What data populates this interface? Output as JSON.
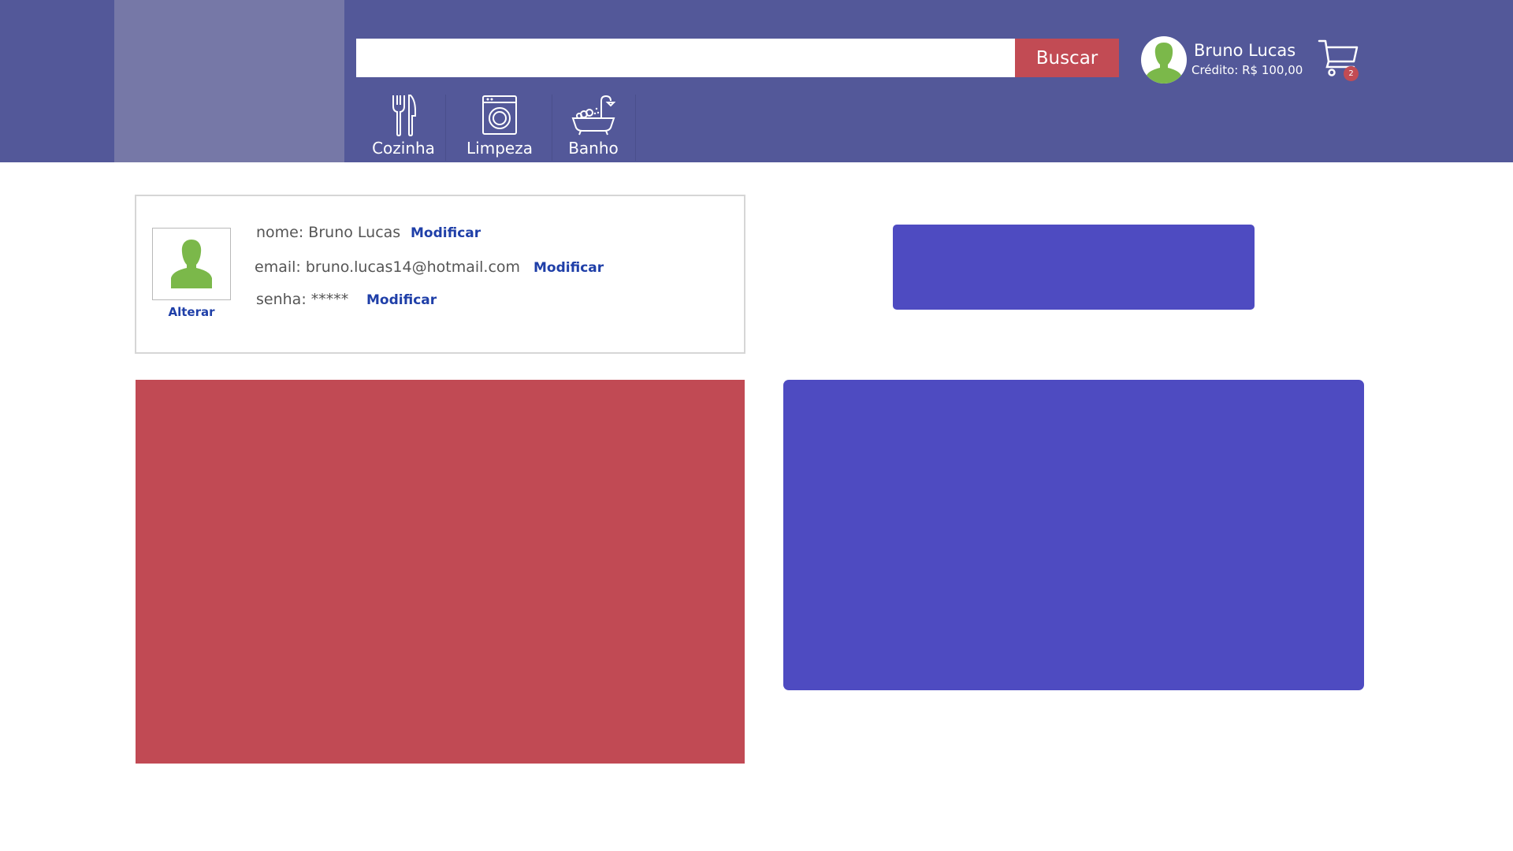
{
  "search": {
    "placeholder": "",
    "value": "",
    "button_label": "Buscar"
  },
  "user": {
    "name": "Bruno Lucas",
    "credit": "Crédito: R$ 100,00"
  },
  "cart": {
    "badge_count": "2"
  },
  "nav": {
    "items": [
      {
        "label": "Cozinha",
        "icon": "cutlery-icon"
      },
      {
        "label": "Limpeza",
        "icon": "washing-machine-icon"
      },
      {
        "label": "Banho",
        "icon": "bathtub-icon"
      }
    ]
  },
  "profile": {
    "change_photo_label": "Alterar",
    "name_label": "nome: Bruno Lucas",
    "email_label": "email: bruno.lucas14@hotmail.com",
    "password_label": "senha: *****",
    "modify_label": "Modificar"
  },
  "colors": {
    "header": "#535899",
    "logo_area": "#7678a7",
    "accent_red": "#c24b54",
    "accent_blue": "#4e4bc1",
    "avatar_green": "#7bb84a",
    "link_blue": "#1f3fa8"
  }
}
